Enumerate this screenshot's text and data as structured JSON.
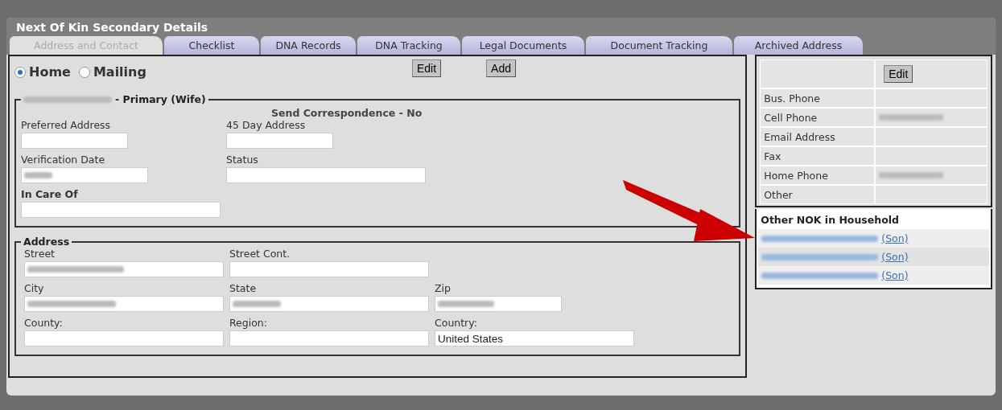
{
  "window": {
    "title": "Next Of Kin Secondary Details"
  },
  "tabs": [
    {
      "label": "Address and Contact",
      "selected": true
    },
    {
      "label": "Checklist",
      "selected": false
    },
    {
      "label": "DNA Records",
      "selected": false
    },
    {
      "label": "DNA Tracking",
      "selected": false
    },
    {
      "label": "Legal Documents",
      "selected": false
    },
    {
      "label": "Document Tracking",
      "selected": false
    },
    {
      "label": "Archived Address",
      "selected": false
    }
  ],
  "address_type": [
    {
      "label": "Home",
      "selected": true
    },
    {
      "label": "Mailing",
      "selected": false
    }
  ],
  "buttons": [
    "Edit",
    "Add"
  ],
  "primary_contact": {
    "name_redacted": true,
    "legend": "- Primary (Wife)",
    "correspondence": "Send Correspondence - No",
    "fields": [
      {
        "label": "Preferred Address",
        "bold": false,
        "redacted": false
      },
      {
        "label": "45 Day Address",
        "bold": false,
        "redacted": false
      },
      {
        "label": "Verification Date",
        "bold": false,
        "redacted": true
      },
      {
        "label": "Status",
        "bold": false,
        "redacted": false
      },
      {
        "label": "In Care Of",
        "bold": true,
        "redacted": false
      }
    ]
  },
  "address": {
    "legend": "Address",
    "fields": [
      {
        "label": "Street",
        "redacted": true
      },
      {
        "label": "Street Cont.",
        "redacted": false
      },
      {
        "label": "City",
        "redacted": true
      },
      {
        "label": "State",
        "redacted": true
      },
      {
        "label": "Zip",
        "redacted": true
      },
      {
        "label": "County:",
        "redacted": false
      },
      {
        "label": "Region:",
        "redacted": false
      },
      {
        "label": "Country:",
        "redacted": false,
        "value": "United States"
      }
    ]
  },
  "contact": {
    "button": "Edit",
    "rows": [
      {
        "label": "Bus. Phone",
        "redacted": false
      },
      {
        "label": "Cell Phone",
        "redacted": true
      },
      {
        "label": "Email Address",
        "redacted": false
      },
      {
        "label": "Fax",
        "redacted": false
      },
      {
        "label": "Home Phone",
        "redacted": true
      },
      {
        "label": "Other",
        "redacted": false
      }
    ]
  },
  "household": {
    "title": "Other NOK in Household",
    "members": [
      {
        "name_redacted": true,
        "relation": "(Son)"
      },
      {
        "name_redacted": true,
        "relation": "(Son)"
      },
      {
        "name_redacted": true,
        "relation": "(Son)"
      }
    ]
  }
}
